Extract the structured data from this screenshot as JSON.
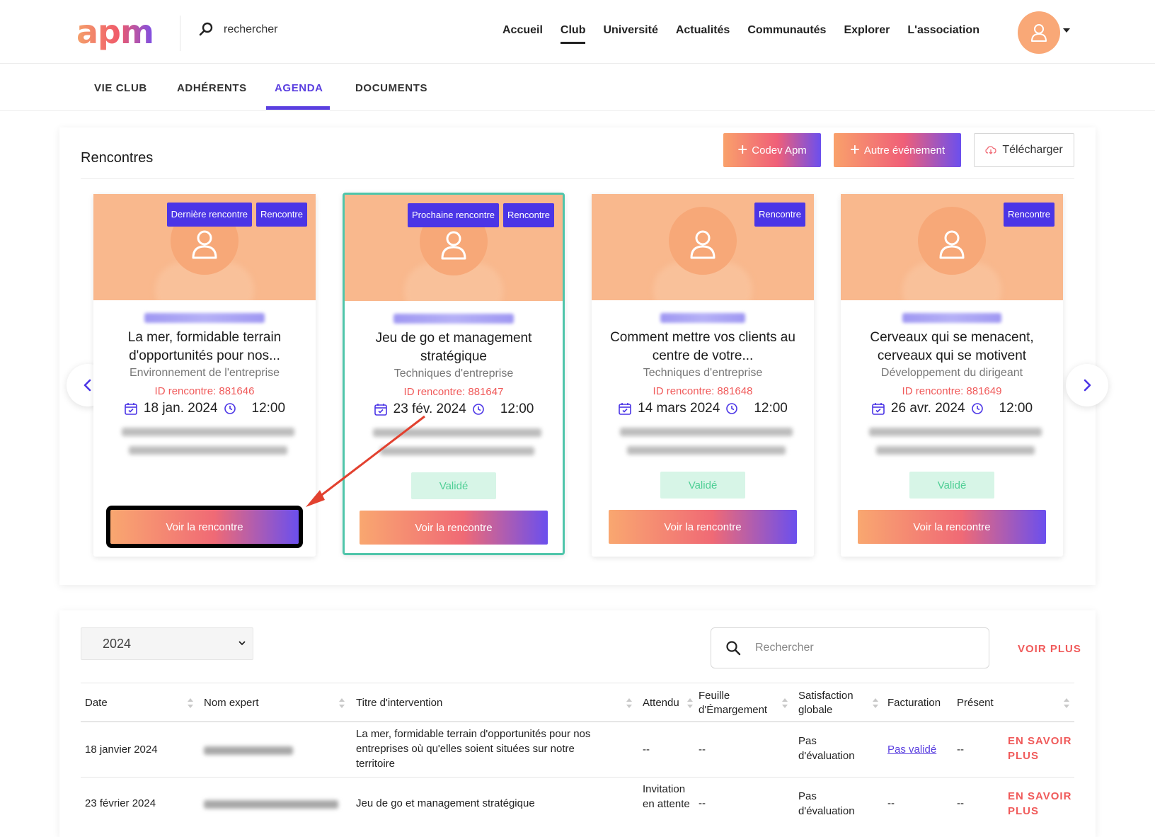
{
  "header": {
    "logo": "apm",
    "search_label": "rechercher",
    "nav": [
      {
        "label": "Accueil"
      },
      {
        "label": "Club",
        "active": true
      },
      {
        "label": "Université"
      },
      {
        "label": "Actualités"
      },
      {
        "label": "Communautés"
      },
      {
        "label": "Explorer"
      },
      {
        "label": "L'association"
      }
    ]
  },
  "subnav": [
    "VIE CLUB",
    "ADHÉRENTS",
    "AGENDA",
    "DOCUMENTS"
  ],
  "rencontres": {
    "title": "Rencontres",
    "btn_codev": "Codev Apm",
    "btn_autre": "Autre événement",
    "btn_telecharger": "Télécharger",
    "cards": [
      {
        "badges": [
          "Dernière rencontre",
          "Rencontre"
        ],
        "title": "La mer, formidable terrain d'opportunités pour nos...",
        "category": "Environnement de l'entreprise",
        "id_label": "ID rencontre: 881646",
        "date": "18 jan. 2024",
        "time": "12:00",
        "status": "",
        "button": "Voir la rencontre"
      },
      {
        "badges": [
          "Prochaine rencontre",
          "Rencontre"
        ],
        "title": "Jeu de go et management stratégique",
        "category": "Techniques d'entreprise",
        "id_label": "ID rencontre: 881647",
        "date": "23 fév. 2024",
        "time": "12:00",
        "status": "Validé",
        "button": "Voir la rencontre"
      },
      {
        "badges": [
          "Rencontre"
        ],
        "title": "Comment mettre vos clients au centre de votre...",
        "category": "Techniques d'entreprise",
        "id_label": "ID rencontre: 881648",
        "date": "14 mars 2024",
        "time": "12:00",
        "status": "Validé",
        "button": "Voir la rencontre"
      },
      {
        "badges": [
          "Rencontre"
        ],
        "title": "Cerveaux qui se menacent, cerveaux qui se motivent",
        "category": "Développement du dirigeant",
        "id_label": "ID rencontre: 881649",
        "date": "26 avr. 2024",
        "time": "12:00",
        "status": "Validé",
        "button": "Voir la rencontre"
      }
    ]
  },
  "table": {
    "year": "2024",
    "search_placeholder": "Rechercher",
    "voir_plus": "VOIR PLUS",
    "headers": [
      "Date",
      "Nom expert",
      "Titre d'intervention",
      "Attendu",
      "Feuille d'Émargement",
      "Satisfaction globale",
      "Facturation",
      "Présent"
    ],
    "rows": [
      {
        "date": "18 janvier 2024",
        "titre": "La mer, formidable terrain d'opportunités pour nos entreprises où qu'elles soient situées sur notre territoire",
        "attendu": "--",
        "feuille": "--",
        "satisfaction": "Pas d'évaluation",
        "facturation": "Pas validé",
        "present": "--",
        "action": "EN SAVOIR PLUS"
      },
      {
        "date": "23 février 2024",
        "titre": "Jeu de go et management stratégique",
        "attendu": "Invitation en attente",
        "feuille": "--",
        "satisfaction": "Pas d'évaluation",
        "facturation": "--",
        "present": "--",
        "action": "EN SAVOIR PLUS"
      }
    ]
  }
}
